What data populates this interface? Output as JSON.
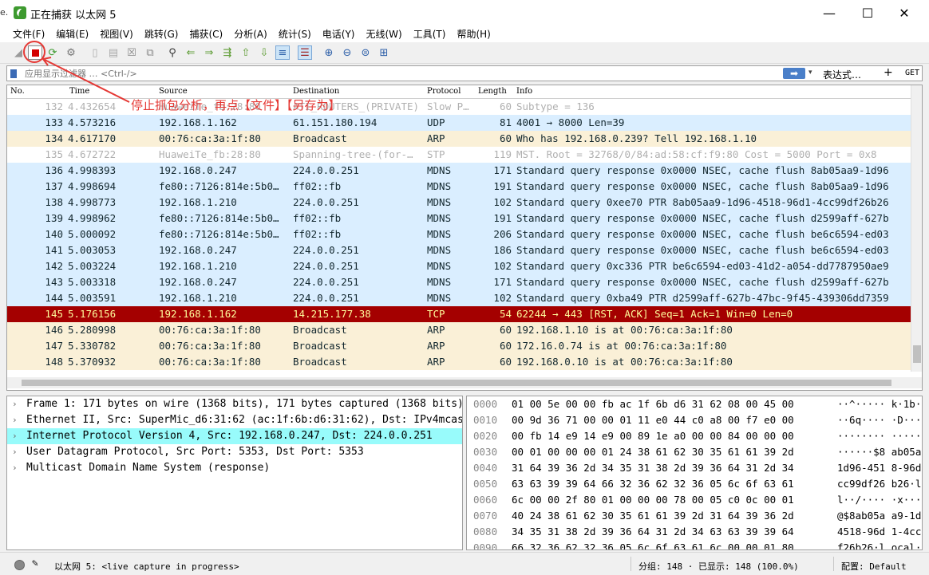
{
  "window": {
    "edge_text": "e.",
    "title": "正在捕获 以太网 5",
    "minimize": "—",
    "maximize": "☐",
    "close": "✕"
  },
  "menu": [
    "文件(F)",
    "编辑(E)",
    "视图(V)",
    "跳转(G)",
    "捕获(C)",
    "分析(A)",
    "统计(S)",
    "电话(Y)",
    "无线(W)",
    "工具(T)",
    "帮助(H)"
  ],
  "filter": {
    "placeholder": "应用显示过滤器 … <Ctrl-/>",
    "apply_arrow": "➡",
    "dropdown": "▾",
    "expression_label": "表达式…",
    "plus": "+",
    "bookmark_label": "GET"
  },
  "annotation": "停止抓包分析，再点【文件】【另存为】",
  "columns": [
    "No.",
    "Time",
    "Source",
    "Destination",
    "Protocol",
    "Length",
    "Info"
  ],
  "packets": [
    {
      "no": "132",
      "time": "4.432654",
      "src": "HuaweiTe_fb:28:80",
      "dst": "ATI_ROUTERS_(PRIVATE)",
      "proto": "Slow P…",
      "len": "60",
      "info": "Subtype = 136",
      "bg": "#ffffff",
      "fg": "#b0b0b0"
    },
    {
      "no": "133",
      "time": "4.573216",
      "src": "192.168.1.162",
      "dst": "61.151.180.194",
      "proto": "UDP",
      "len": "81",
      "info": "4001 → 8000 Len=39",
      "bg": "#daeeff",
      "fg": "#12272e"
    },
    {
      "no": "134",
      "time": "4.617170",
      "src": "00:76:ca:3a:1f:80",
      "dst": "Broadcast",
      "proto": "ARP",
      "len": "60",
      "info": "Who has 192.168.0.239? Tell 192.168.1.10",
      "bg": "#faf0d7",
      "fg": "#12272e"
    },
    {
      "no": "135",
      "time": "4.672722",
      "src": "HuaweiTe_fb:28:80",
      "dst": "Spanning-tree-(for-…",
      "proto": "STP",
      "len": "119",
      "info": "MST. Root = 32768/0/84:ad:58:cf:f9:80  Cost = 5000  Port = 0x8",
      "bg": "#ffffff",
      "fg": "#b0b0b0"
    },
    {
      "no": "136",
      "time": "4.998393",
      "src": "192.168.0.247",
      "dst": "224.0.0.251",
      "proto": "MDNS",
      "len": "171",
      "info": "Standard query response 0x0000 NSEC, cache flush 8ab05aa9-1d96",
      "bg": "#daeeff",
      "fg": "#12272e"
    },
    {
      "no": "137",
      "time": "4.998694",
      "src": "fe80::7126:814e:5b0…",
      "dst": "ff02::fb",
      "proto": "MDNS",
      "len": "191",
      "info": "Standard query response 0x0000 NSEC, cache flush 8ab05aa9-1d96",
      "bg": "#daeeff",
      "fg": "#12272e"
    },
    {
      "no": "138",
      "time": "4.998773",
      "src": "192.168.1.210",
      "dst": "224.0.0.251",
      "proto": "MDNS",
      "len": "102",
      "info": "Standard query 0xee70 PTR 8ab05aa9-1d96-4518-96d1-4cc99df26b26",
      "bg": "#daeeff",
      "fg": "#12272e"
    },
    {
      "no": "139",
      "time": "4.998962",
      "src": "fe80::7126:814e:5b0…",
      "dst": "ff02::fb",
      "proto": "MDNS",
      "len": "191",
      "info": "Standard query response 0x0000 NSEC, cache flush d2599aff-627b",
      "bg": "#daeeff",
      "fg": "#12272e"
    },
    {
      "no": "140",
      "time": "5.000092",
      "src": "fe80::7126:814e:5b0…",
      "dst": "ff02::fb",
      "proto": "MDNS",
      "len": "206",
      "info": "Standard query response 0x0000 NSEC, cache flush be6c6594-ed03",
      "bg": "#daeeff",
      "fg": "#12272e"
    },
    {
      "no": "141",
      "time": "5.003053",
      "src": "192.168.0.247",
      "dst": "224.0.0.251",
      "proto": "MDNS",
      "len": "186",
      "info": "Standard query response 0x0000 NSEC, cache flush be6c6594-ed03",
      "bg": "#daeeff",
      "fg": "#12272e"
    },
    {
      "no": "142",
      "time": "5.003224",
      "src": "192.168.1.210",
      "dst": "224.0.0.251",
      "proto": "MDNS",
      "len": "102",
      "info": "Standard query 0xc336 PTR be6c6594-ed03-41d2-a054-dd7787950ae9",
      "bg": "#daeeff",
      "fg": "#12272e"
    },
    {
      "no": "143",
      "time": "5.003318",
      "src": "192.168.0.247",
      "dst": "224.0.0.251",
      "proto": "MDNS",
      "len": "171",
      "info": "Standard query response 0x0000 NSEC, cache flush d2599aff-627b",
      "bg": "#daeeff",
      "fg": "#12272e"
    },
    {
      "no": "144",
      "time": "5.003591",
      "src": "192.168.1.210",
      "dst": "224.0.0.251",
      "proto": "MDNS",
      "len": "102",
      "info": "Standard query 0xba49 PTR d2599aff-627b-47bc-9f45-439306dd7359",
      "bg": "#daeeff",
      "fg": "#12272e"
    },
    {
      "no": "145",
      "time": "5.176156",
      "src": "192.168.1.162",
      "dst": "14.215.177.38",
      "proto": "TCP",
      "len": "54",
      "info": "62244 → 443 [RST, ACK] Seq=1 Ack=1 Win=0 Len=0",
      "bg": "#a40000",
      "fg": "#fffc9c"
    },
    {
      "no": "146",
      "time": "5.280998",
      "src": "00:76:ca:3a:1f:80",
      "dst": "Broadcast",
      "proto": "ARP",
      "len": "60",
      "info": "192.168.1.10 is at 00:76:ca:3a:1f:80",
      "bg": "#faf0d7",
      "fg": "#12272e"
    },
    {
      "no": "147",
      "time": "5.330782",
      "src": "00:76:ca:3a:1f:80",
      "dst": "Broadcast",
      "proto": "ARP",
      "len": "60",
      "info": "172.16.0.74 is at 00:76:ca:3a:1f:80",
      "bg": "#faf0d7",
      "fg": "#12272e"
    },
    {
      "no": "148",
      "time": "5.370932",
      "src": "00:76:ca:3a:1f:80",
      "dst": "Broadcast",
      "proto": "ARP",
      "len": "60",
      "info": "192.168.0.10 is at 00:76:ca:3a:1f:80",
      "bg": "#faf0d7",
      "fg": "#12272e"
    }
  ],
  "details": [
    "Frame 1: 171 bytes on wire (1368 bits), 171 bytes captured (1368 bits)",
    "Ethernet II, Src: SuperMic_d6:31:62 (ac:1f:6b:d6:31:62), Dst: IPv4mcast_fb",
    "Internet Protocol Version 4, Src: 192.168.0.247, Dst: 224.0.0.251",
    "User Datagram Protocol, Src Port: 5353, Dst Port: 5353",
    "Multicast Domain Name System (response)"
  ],
  "selected_detail": 2,
  "hex": [
    {
      "off": "0000",
      "bytes": "01 00 5e 00 00 fb ac 1f  6b d6 31 62 08 00 45 00",
      "ascii": "··^····· k·1b··E·"
    },
    {
      "off": "0010",
      "bytes": "00 9d 36 71 00 00 01 11  e0 44 c0 a8 00 f7 e0 00",
      "ascii": "··6q···· ·D······"
    },
    {
      "off": "0020",
      "bytes": "00 fb 14 e9 14 e9 00 89  1e a0 00 00 84 00 00 00",
      "ascii": "········ ········"
    },
    {
      "off": "0030",
      "bytes": "00 01 00 00 00 01 24 38  61 62 30 35 61 61 39 2d",
      "ascii": "······$8 ab05aa9-"
    },
    {
      "off": "0040",
      "bytes": "31 64 39 36 2d 34 35 31  38 2d 39 36 64 31 2d 34",
      "ascii": "1d96-451 8-96d1-4"
    },
    {
      "off": "0050",
      "bytes": "63 63 39 39 64 66 32 36  62 32 36 05 6c 6f 63 61",
      "ascii": "cc99df26 b26·loca"
    },
    {
      "off": "0060",
      "bytes": "6c 00 00 2f 80 01 00 00  00 78 00 05 c0 0c 00 01",
      "ascii": "l··/···· ·x······"
    },
    {
      "off": "0070",
      "bytes": "40 24 38 61 62 30 35 61  61 39 2d 31 64 39 36 2d",
      "ascii": "@$8ab05a a9-1d96-"
    },
    {
      "off": "0080",
      "bytes": "34 35 31 38 2d 39 36 64  31 2d 34 63 63 39 39 64",
      "ascii": "4518-96d 1-4cc99d"
    },
    {
      "off": "0090",
      "bytes": "66 32 36 62 32 36 05 6c  6f 63 61 6c 00 00 01 80",
      "ascii": "f26b26·l ocal····"
    }
  ],
  "status": {
    "interface": "以太网 5: <live capture in progress>",
    "packets": "分组: 148 · 已显示: 148 (100.0%)",
    "profile": "配置: Default"
  }
}
